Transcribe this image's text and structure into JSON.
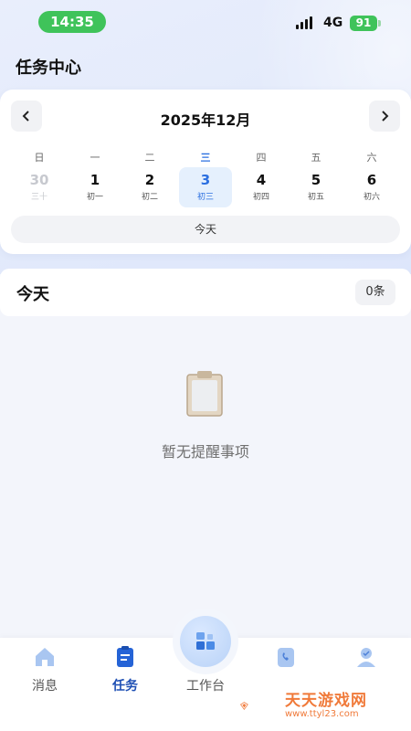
{
  "status_bar": {
    "time": "14:35",
    "network": "4G",
    "battery": "91"
  },
  "header": {
    "title": "任务中心"
  },
  "calendar": {
    "month_label": "2025年12月",
    "weekdays": [
      "日",
      "一",
      "二",
      "三",
      "四",
      "五",
      "六"
    ],
    "active_weekday_index": 3,
    "days": [
      {
        "num": "30",
        "lunar": "三十",
        "state": "other-month"
      },
      {
        "num": "1",
        "lunar": "初一",
        "state": "normal"
      },
      {
        "num": "2",
        "lunar": "初二",
        "state": "normal"
      },
      {
        "num": "3",
        "lunar": "初三",
        "state": "selected"
      },
      {
        "num": "4",
        "lunar": "初四",
        "state": "normal"
      },
      {
        "num": "5",
        "lunar": "初五",
        "state": "normal"
      },
      {
        "num": "6",
        "lunar": "初六",
        "state": "normal"
      }
    ],
    "today_button": "今天"
  },
  "section": {
    "title": "今天",
    "count": "0条"
  },
  "empty_state": {
    "text": "暂无提醒事项",
    "icon": "clipboard-icon"
  },
  "tabbar": {
    "items": [
      {
        "label": "消息",
        "icon": "home-icon"
      },
      {
        "label": "任务",
        "icon": "task-clipboard-icon",
        "active": true
      },
      {
        "label": "工作台",
        "icon": "workbench-grid-icon"
      },
      {
        "label": "",
        "icon": "phone-book-icon"
      },
      {
        "label": "",
        "icon": "profile-icon"
      }
    ]
  },
  "watermark": {
    "title": "天天游戏网",
    "url": "www.ttyl23.com"
  },
  "colors": {
    "accent": "#2b6fe0",
    "status_green": "#3fc35a",
    "watermark": "#f07a3a"
  }
}
